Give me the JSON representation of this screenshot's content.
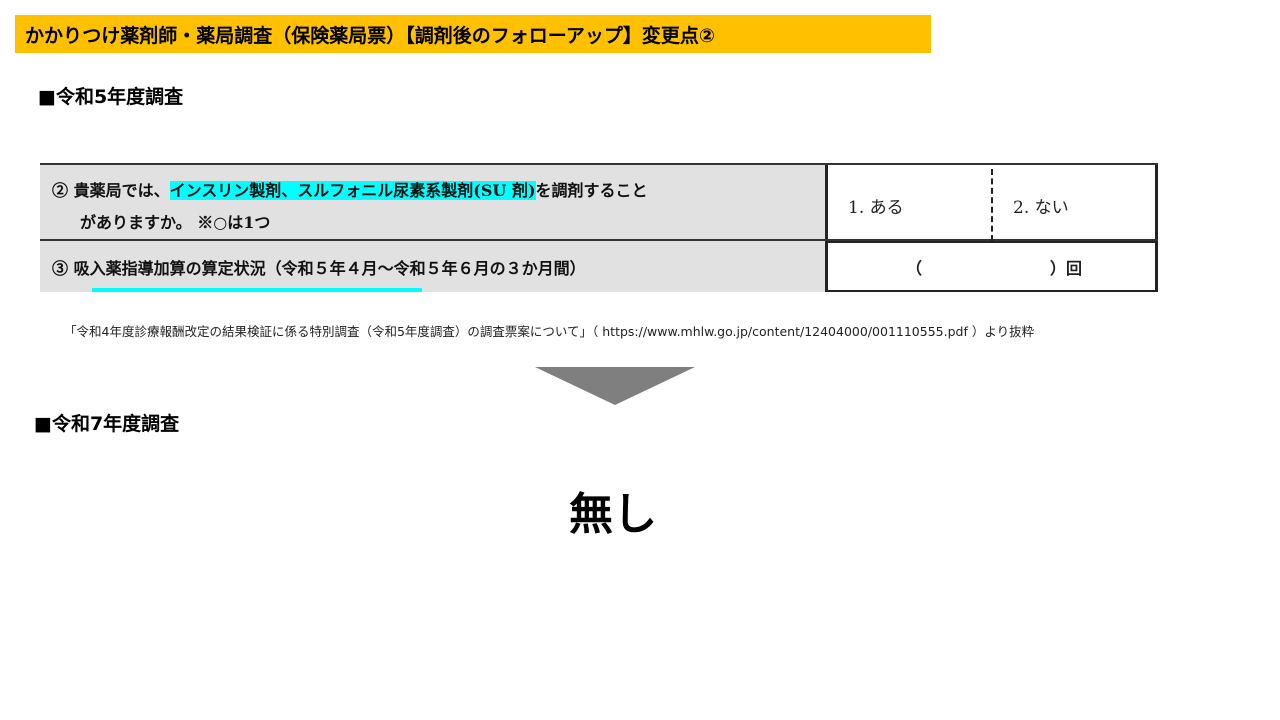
{
  "title": "かかりつけ薬剤師・薬局調査（保険薬局票）【調剤後のフォローアップ】変更点②",
  "section1_heading": "■令和5年度調査",
  "section2_heading": "■令和7年度調査",
  "table": {
    "q2": {
      "num": "②",
      "prefix": "貴薬局では、",
      "highlight": "インスリン製剤、スルフォニル尿素系製剤(SU 剤)",
      "suffix": "を調剤すること",
      "line2": "がありますか。 ※○は1つ",
      "options": [
        "1. ある",
        "2. ない"
      ]
    },
    "q3": {
      "text": "③ 吸入薬指導加算の算定状況（令和５年４月～令和５年６月の３か月間）",
      "answer_open": "（",
      "answer_close": "）回"
    }
  },
  "source_note": "「令和4年度診療報酬改定の結果検証に係る特別調査（令和5年度調査）の調査票案について」（ https://www.mhlw.go.jp/content/12404000/001110555.pdf ）より抜粋",
  "result_text": "無し",
  "colors": {
    "title_bg": "#ffc000",
    "highlight": "#00ffff",
    "arrow": "#7f7f7f",
    "question_bg": "#e1e1e1"
  }
}
